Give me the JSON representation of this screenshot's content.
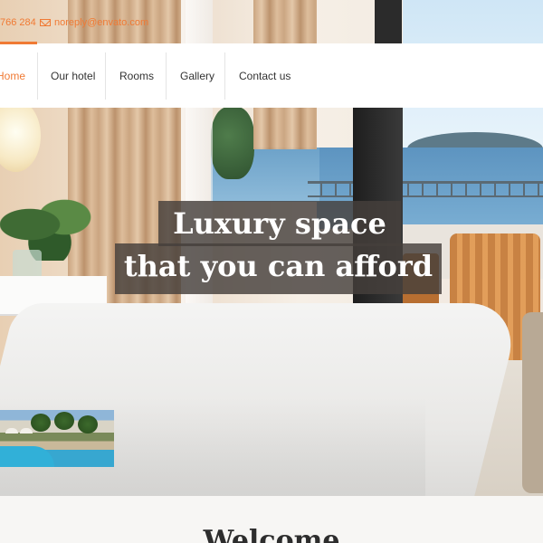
{
  "topbar": {
    "phone": "766 284",
    "email": "noreply@envato.com"
  },
  "nav": {
    "items": [
      {
        "label": "Home",
        "active": true
      },
      {
        "label": "Our hotel",
        "active": false
      },
      {
        "label": "Rooms",
        "active": false
      },
      {
        "label": "Gallery",
        "active": false
      },
      {
        "label": "Contact us",
        "active": false
      }
    ]
  },
  "hero": {
    "headline_line1": "Luxury space",
    "headline_line2": "that you can afford"
  },
  "welcome": {
    "title": "Welcome"
  },
  "colors": {
    "accent": "#f07a34",
    "nav_text": "#333333",
    "headline_bg": "#46403c"
  },
  "icons": [
    "email-icon"
  ]
}
